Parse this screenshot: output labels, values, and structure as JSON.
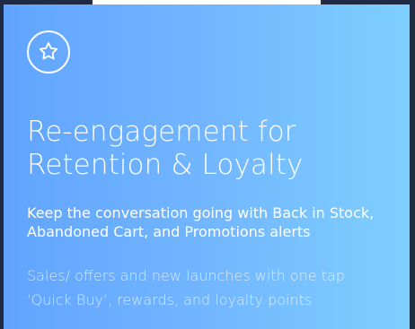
{
  "card": {
    "icon": "star-icon",
    "headline": {
      "line1": "Re-engagement for",
      "line2": "Retention & Loyalty"
    },
    "subheadline": {
      "line1": "Keep the conversation going with Back in Stock,",
      "line2": "Abandoned Cart, and Promotions alerts"
    },
    "description": {
      "line1": "Sales/ offers and new launches with one tap",
      "line2": "‘Quick Buy’, rewards, and loyalty points"
    },
    "colors": {
      "gradient_start": "#61a4ff",
      "gradient_end": "#7ecfff",
      "text_primary": "#ffffff",
      "text_secondary": "#e3f2ff"
    }
  }
}
